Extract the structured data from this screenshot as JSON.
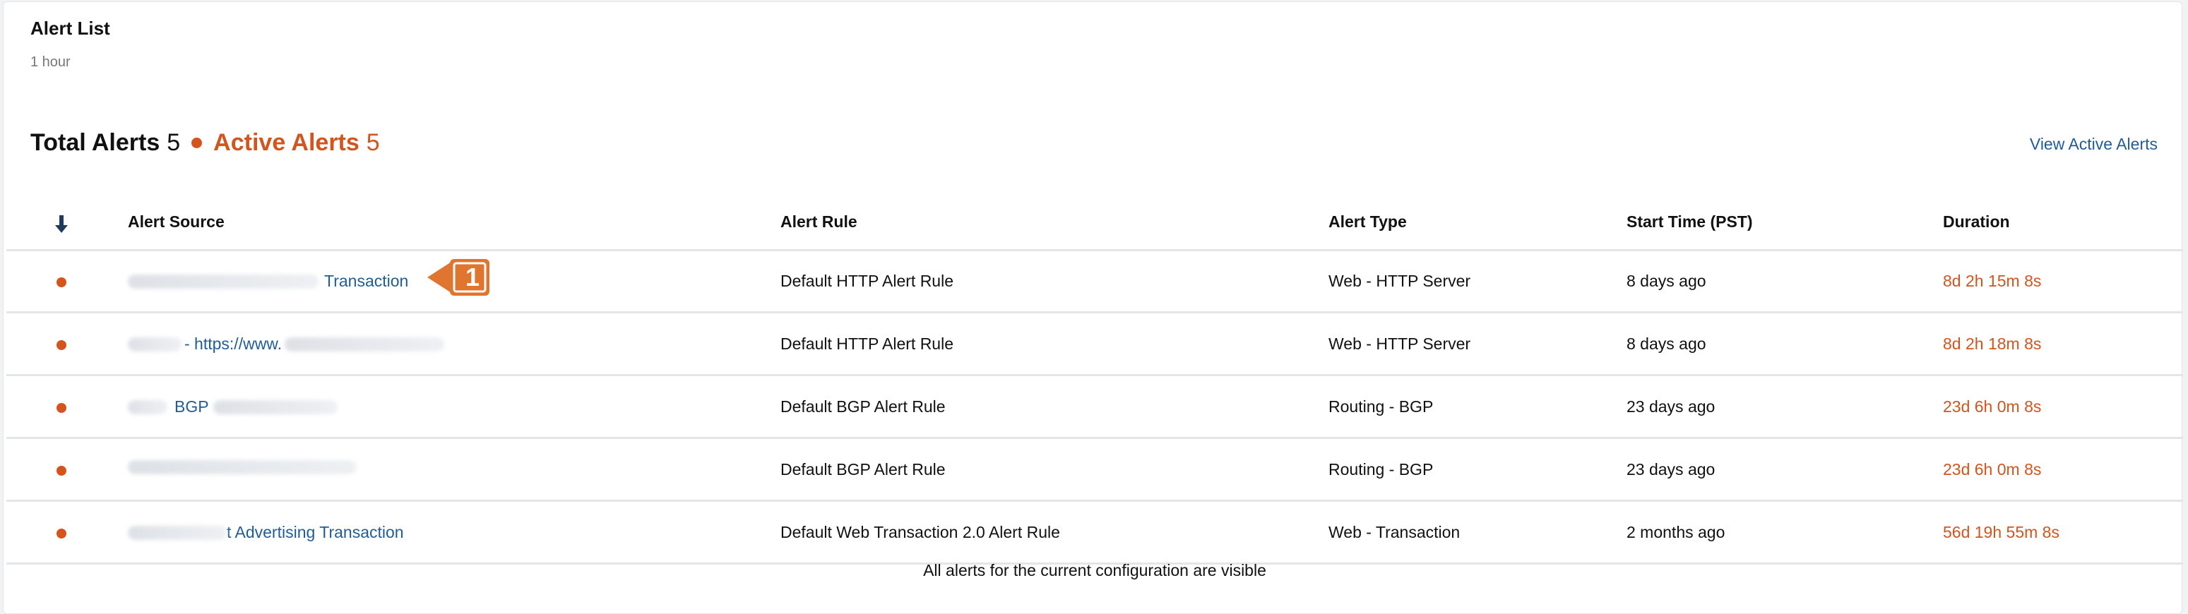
{
  "header": {
    "title": "Alert List",
    "subtitle": "1 hour"
  },
  "summary": {
    "total_label": "Total Alerts",
    "total_count": "5",
    "active_label": "Active Alerts",
    "active_count": "5",
    "view_link": "View Active Alerts"
  },
  "table": {
    "sort_icon": "sort-down-arrow-icon",
    "columns": [
      "Alert Source",
      "Alert Rule",
      "Alert Type",
      "Start Time (PST)",
      "Duration"
    ],
    "rows": [
      {
        "source_prefix": "",
        "source_suffix": "Transaction",
        "rule": "Default HTTP Alert Rule",
        "type": "Web - HTTP Server",
        "start": "8 days ago",
        "duration": "8d 2h 15m 8s"
      },
      {
        "source_prefix": "- https://www.",
        "source_suffix": "",
        "rule": "Default HTTP Alert Rule",
        "type": "Web - HTTP Server",
        "start": "8 days ago",
        "duration": "8d 2h 18m 8s"
      },
      {
        "source_prefix": "BGP",
        "source_suffix": "",
        "rule": "Default BGP Alert Rule",
        "type": "Routing - BGP",
        "start": "23 days ago",
        "duration": "23d 6h 0m 8s"
      },
      {
        "source_prefix": "",
        "source_suffix": "",
        "rule": "Default BGP Alert Rule",
        "type": "Routing - BGP",
        "start": "23 days ago",
        "duration": "23d 6h 0m 8s"
      },
      {
        "source_prefix": "",
        "source_suffix": "t Advertising Transaction",
        "rule": "Default Web Transaction 2.0 Alert Rule",
        "type": "Web - Transaction",
        "start": "2 months ago",
        "duration": "56d 19h 55m 8s"
      }
    ]
  },
  "callout": {
    "number": "1"
  },
  "footer": {
    "text": "All alerts for the current configuration are visible"
  },
  "colors": {
    "accent": "#d4541c",
    "link": "#1f5d99",
    "text": "#111111",
    "divider": "#e3e5e8"
  }
}
